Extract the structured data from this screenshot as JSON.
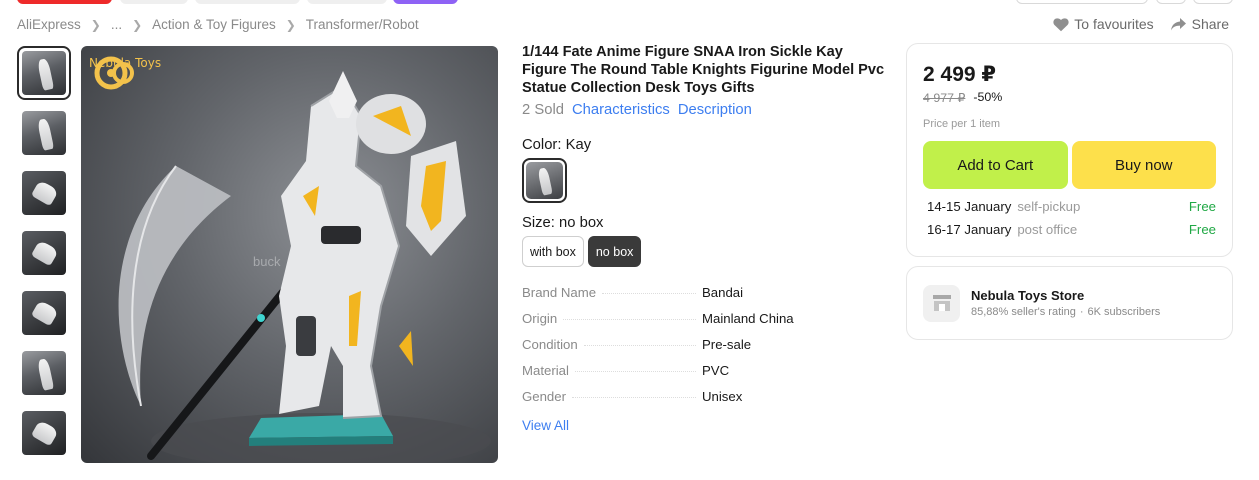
{
  "breadcrumb": [
    "AliExpress",
    "...",
    "Action & Toy Figures",
    "Transformer/Robot"
  ],
  "header_actions": {
    "favourites": "To favourites",
    "share": "Share"
  },
  "gallery": {
    "logo_text": "Nebula Toys",
    "watermark": "buck",
    "thumbnail_count": 7
  },
  "product": {
    "title": "1/144 Fate Anime Figure SNAA Iron Sickle Kay Figure The Round Table Knights Figurine Model Pvc Statue Collection Desk Toys Gifts",
    "sold": "2 Sold",
    "tabs": [
      "Characteristics",
      "Description"
    ],
    "color_label": "Color:",
    "color_value": "Kay",
    "size_label": "Size:",
    "size_value": "no box",
    "sizes": [
      "with box",
      "no box"
    ],
    "specs": [
      {
        "key": "Brand Name",
        "value": "Bandai"
      },
      {
        "key": "Origin",
        "value": "Mainland China"
      },
      {
        "key": "Condition",
        "value": "Pre-sale"
      },
      {
        "key": "Material",
        "value": "PVC"
      },
      {
        "key": "Gender",
        "value": "Unisex"
      }
    ],
    "view_all": "View All"
  },
  "price_card": {
    "price": "2 499 ₽",
    "old_price": "4 977 ₽",
    "discount": "-50%",
    "per_item": "Price per 1 item",
    "add_to_cart": "Add to Cart",
    "buy_now": "Buy now",
    "delivery": [
      {
        "date": "14-15 January",
        "method": "self-pickup",
        "cost": "Free"
      },
      {
        "date": "16-17 January",
        "method": "post office",
        "cost": "Free"
      }
    ]
  },
  "store": {
    "name": "Nebula Toys Store",
    "rating": "85,88% seller's rating",
    "subscribers": "6K subscribers"
  },
  "colors": {
    "accent_link": "#3d7ef0",
    "cart_button": "#c1f04a",
    "buy_button": "#fde04b",
    "free_text": "#20a845"
  }
}
